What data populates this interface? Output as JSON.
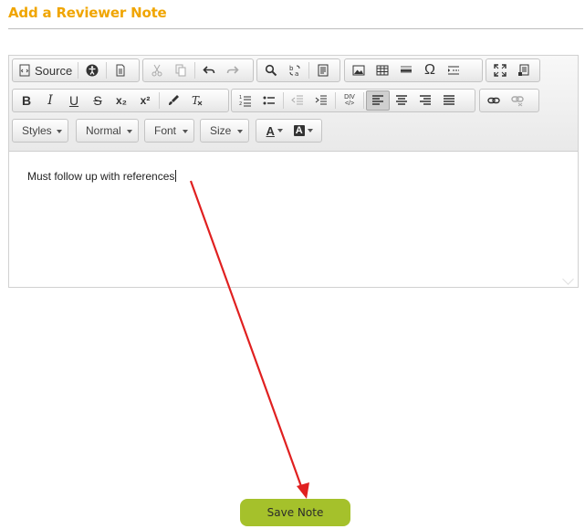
{
  "page": {
    "title": "Add a Reviewer Note"
  },
  "toolbar": {
    "source_label": "Source",
    "styles_label": "Styles",
    "format_label": "Normal",
    "font_label": "Font",
    "size_label": "Size",
    "bold": "B",
    "italic": "I",
    "underline": "U",
    "strike": "S",
    "subscript": "x₂",
    "superscript": "x²",
    "text_color": "A",
    "bg_color": "A",
    "omega": "Ω",
    "div": "DIV"
  },
  "editor": {
    "content": "Must follow up with references"
  },
  "actions": {
    "save_label": "Save Note"
  },
  "colors": {
    "title": "#f0a500",
    "save_button": "#a5c12b",
    "arrow": "#e02020"
  }
}
